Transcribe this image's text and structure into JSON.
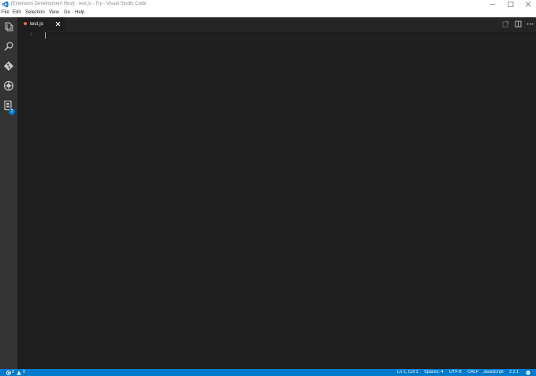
{
  "window": {
    "title": "[Extension Development Host] - test.js - Try - Visual Studio Code"
  },
  "menu": {
    "items": [
      "File",
      "Edit",
      "Selection",
      "View",
      "Go",
      "Help"
    ]
  },
  "activity_bar": {
    "items": [
      "explorer-icon",
      "search-icon",
      "git-icon",
      "debug-icon",
      "extensions-icon"
    ],
    "extensions_badge": "7"
  },
  "tabs": [
    {
      "label": "test.js",
      "icon": "js-file-icon",
      "active": true
    }
  ],
  "editor": {
    "line_numbers": [
      "1"
    ],
    "content": ""
  },
  "status_bar": {
    "errors": "0",
    "warnings": "0",
    "cursor_position": "Ln 1, Col 1",
    "indentation": "Spaces: 4",
    "encoding": "UTF-8",
    "line_endings": "CRLF",
    "language": "JavaScript",
    "version": "2.2.1",
    "feedback_icon": "smiley-icon"
  },
  "colors": {
    "accent": "#007acc",
    "editor_bg": "#1e1e1e",
    "activity_bar_bg": "#333333",
    "tab_strip_bg": "#252526"
  }
}
